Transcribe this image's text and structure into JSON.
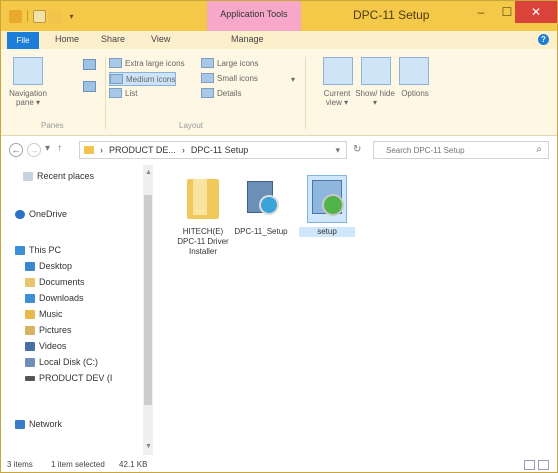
{
  "window": {
    "title": "DPC-11 Setup",
    "context_tab": "Application Tools",
    "min_label": "–",
    "max_label": "☐",
    "close_label": "✕"
  },
  "ribbon_tabs": {
    "file": "File",
    "home": "Home",
    "share": "Share",
    "view": "View",
    "manage": "Manage"
  },
  "ribbon": {
    "navigation_pane": "Navigation pane ▾",
    "panes_group": "Panes",
    "layout_group": "Layout",
    "extra_large_icons": "Extra large icons",
    "large_icons": "Large icons",
    "medium_icons": "Medium icons",
    "small_icons": "Small icons",
    "list": "List",
    "details": "Details",
    "current_view": "Current view ▾",
    "show_hide": "Show/ hide ▾",
    "options": "Options"
  },
  "address": {
    "back": "←",
    "forward": "→",
    "up": "↑",
    "path_root": "PRODUCT DE...",
    "path_sep": "›",
    "path_leaf": "DPC-11 Setup",
    "search_placeholder": "Search DPC-11 Setup"
  },
  "nav": {
    "recent": "Recent places",
    "onedrive": "OneDrive",
    "thispc": "This PC",
    "desktop": "Desktop",
    "documents": "Documents",
    "downloads": "Downloads",
    "music": "Music",
    "pictures": "Pictures",
    "videos": "Videos",
    "localdisk": "Local Disk (C:)",
    "productdev": "PRODUCT DEV (I",
    "network": "Network"
  },
  "files": [
    {
      "name": "HITECH(E) DPC-11 Driver Installer"
    },
    {
      "name": "DPC-11_Setup"
    },
    {
      "name": "setup"
    }
  ],
  "status": {
    "items": "3 items",
    "selected": "1 item selected",
    "size": "42.1 KB"
  },
  "colors": {
    "titlebar": "#f4c94a",
    "context_tab": "#f7a8c9",
    "file_tab": "#1d7ed9",
    "close": "#d9433a"
  }
}
